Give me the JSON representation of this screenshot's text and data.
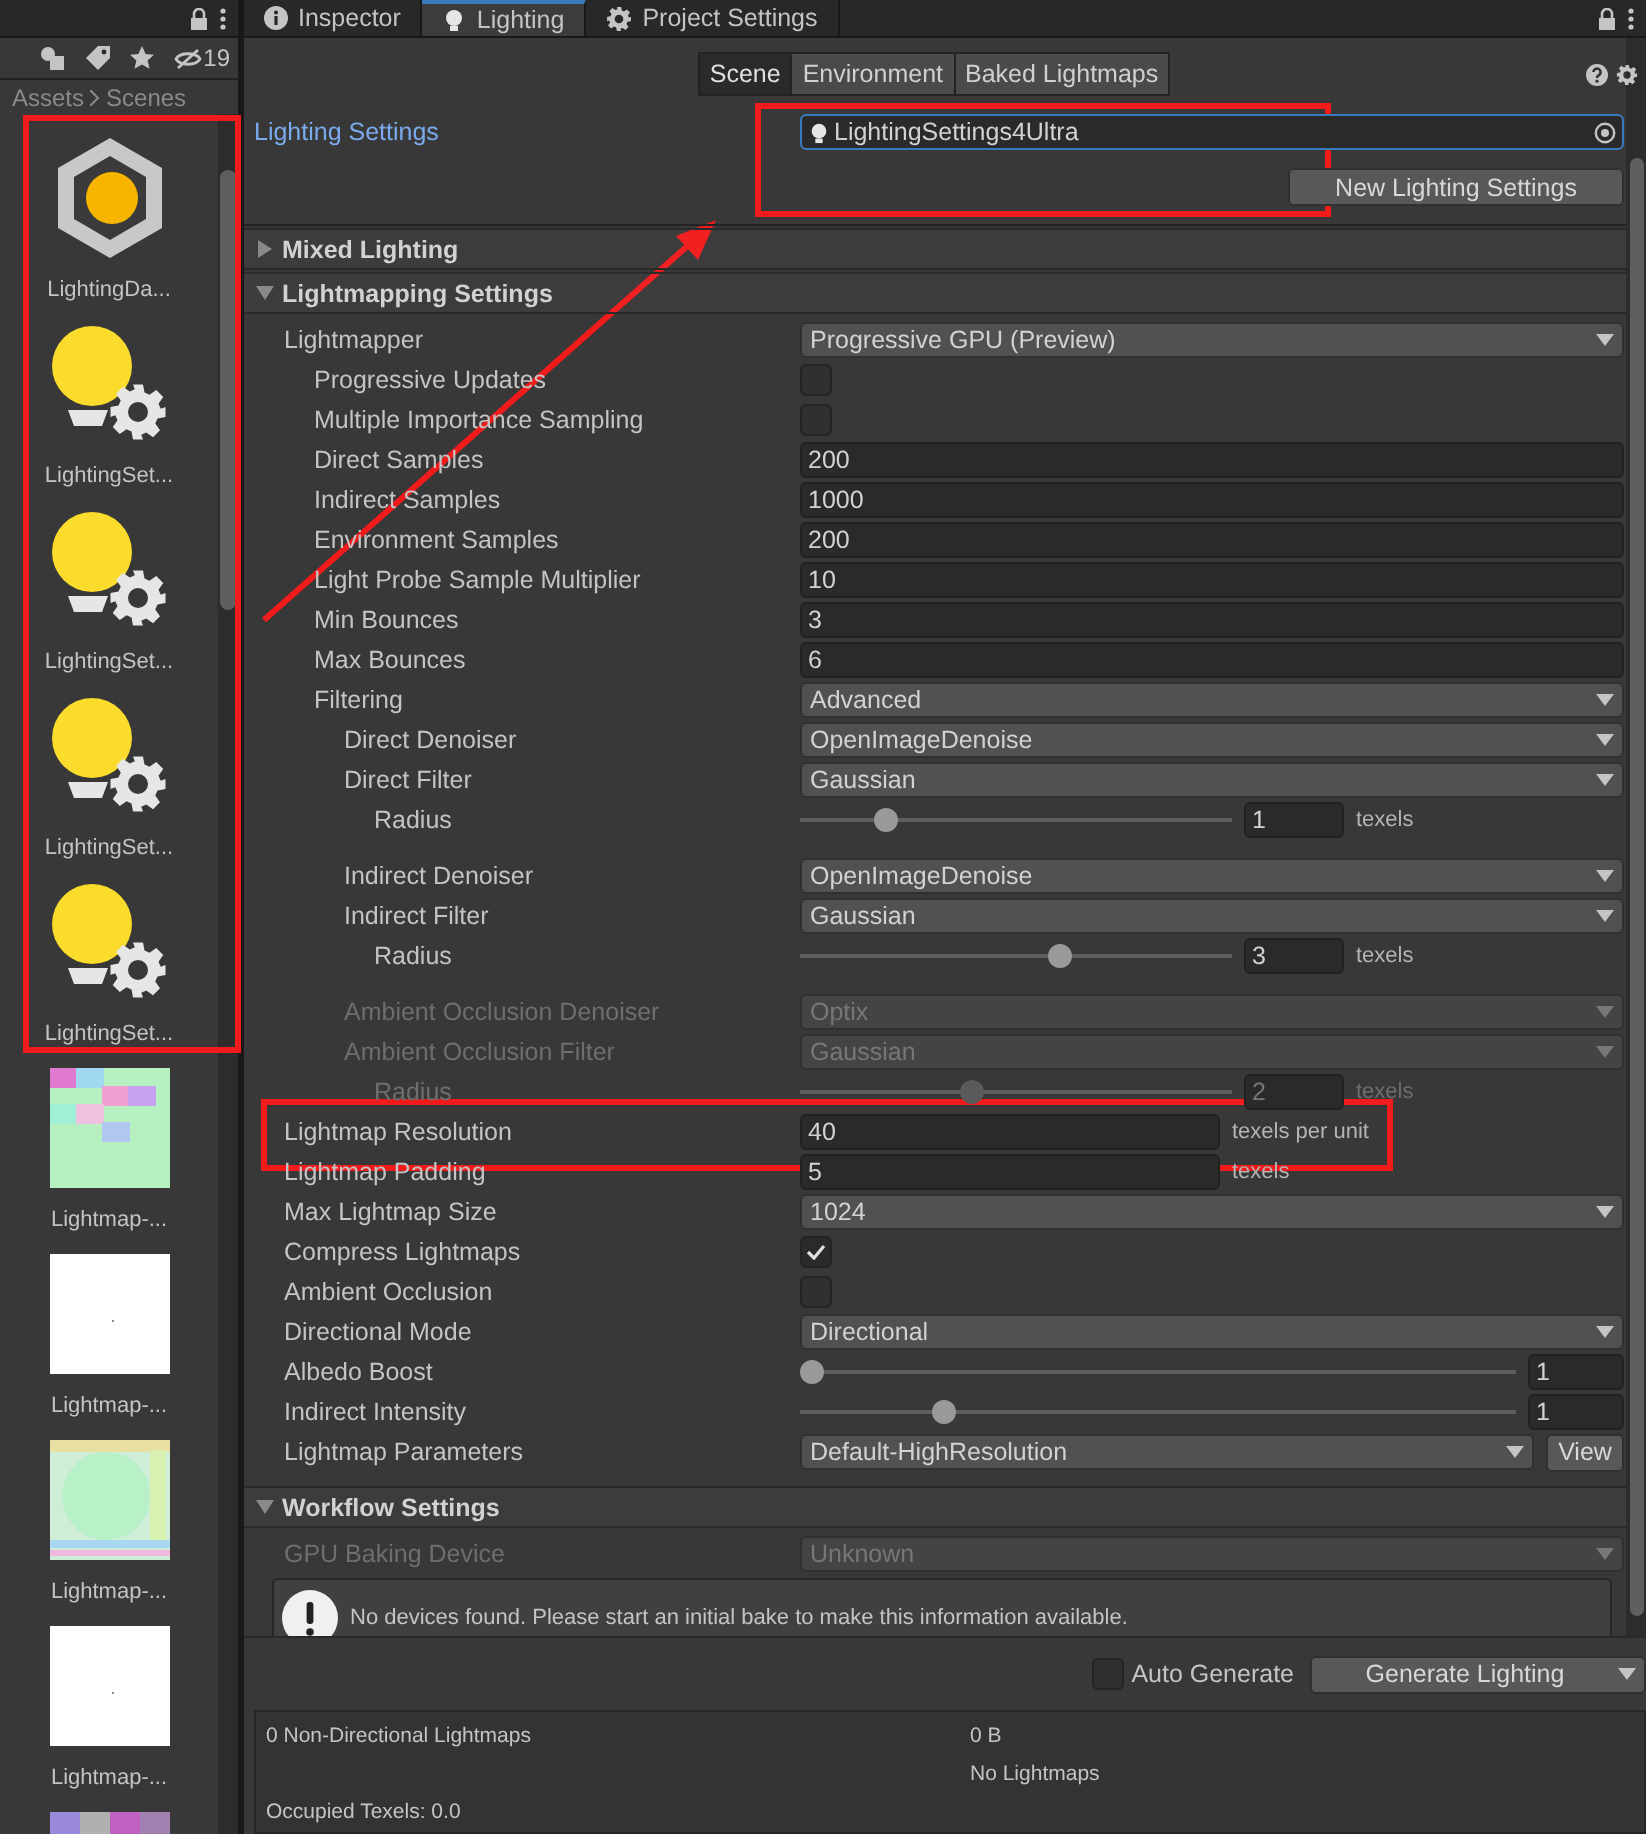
{
  "project_panel": {
    "hidden_count": "19",
    "breadcrumb": [
      "Assets",
      "Scenes"
    ],
    "assets": [
      {
        "kind": "lighting-data",
        "name": "LightingDa..."
      },
      {
        "kind": "lighting-settings",
        "name": "LightingSet..."
      },
      {
        "kind": "lighting-settings",
        "name": "LightingSet..."
      },
      {
        "kind": "lighting-settings",
        "name": "LightingSet..."
      },
      {
        "kind": "lighting-settings",
        "name": "LightingSet..."
      },
      {
        "kind": "picture",
        "name": "Lightmap-..."
      },
      {
        "kind": "picture",
        "name": "Lightmap-..."
      },
      {
        "kind": "picture",
        "name": "Lightmap-..."
      },
      {
        "kind": "picture",
        "name": "Lightmap-..."
      },
      {
        "kind": "picture"
      }
    ]
  },
  "tabs": [
    {
      "label": "Inspector",
      "kind": "info",
      "selected": false
    },
    {
      "label": "Lighting",
      "kind": "bulb",
      "selected": true
    },
    {
      "label": "Project Settings",
      "kind": "gear",
      "selected": false
    }
  ],
  "subtabs": [
    {
      "label": "Scene",
      "selected": true
    },
    {
      "label": "Environment",
      "selected": false
    },
    {
      "label": "Baked Lightmaps",
      "selected": false
    }
  ],
  "lighting_settings": {
    "label": "Lighting Settings",
    "asset": "LightingSettings4Ultra",
    "button": "New Lighting Settings"
  },
  "sections": [
    {
      "title": "Mixed Lighting",
      "expanded": false
    },
    {
      "title": "Lightmapping Settings",
      "expanded": true,
      "rows": [
        {
          "label": "Lightmapper",
          "kind": "dropdown",
          "value": "Progressive GPU (Preview)",
          "children": [
            {
              "label": "Progressive Updates",
              "kind": "checkbox",
              "checked": false
            },
            {
              "label": "Multiple Importance Sampling",
              "kind": "checkbox",
              "checked": false
            },
            {
              "label": "Direct Samples",
              "kind": "number",
              "value": "200"
            },
            {
              "label": "Indirect Samples",
              "kind": "number",
              "value": "1000"
            },
            {
              "label": "Environment Samples",
              "kind": "number",
              "value": "200"
            },
            {
              "label": "Light Probe Sample Multiplier",
              "kind": "number",
              "value": "10"
            },
            {
              "label": "Min Bounces",
              "kind": "number",
              "value": "3"
            },
            {
              "label": "Max Bounces",
              "kind": "number",
              "value": "6"
            },
            {
              "label": "Filtering",
              "kind": "dropdown",
              "value": "Advanced",
              "children": [
                {
                  "label": "Direct Denoiser",
                  "kind": "dropdown",
                  "value": "OpenImageDenoise"
                },
                {
                  "label": "Direct Filter",
                  "kind": "dropdown",
                  "value": "Gaussian",
                  "children": [
                    {
                      "label": "Radius",
                      "kind": "slider",
                      "level": 0.2,
                      "value": "1",
                      "unit": "texels"
                    }
                  ]
                },
                {
                  "label": "Indirect Denoiser",
                  "kind": "dropdown",
                  "value": "OpenImageDenoise"
                },
                {
                  "label": "Indirect Filter",
                  "kind": "dropdown",
                  "value": "Gaussian",
                  "children": [
                    {
                      "label": "Radius",
                      "kind": "slider",
                      "level": 0.6,
                      "value": "3",
                      "unit": "texels"
                    }
                  ]
                },
                {
                  "label": "Ambient Occlusion Denoiser",
                  "kind": "dropdown",
                  "value": "Optix",
                  "disabled": true
                },
                {
                  "label": "Ambient Occlusion Filter",
                  "kind": "dropdown",
                  "value": "Gaussian",
                  "disabled": true,
                  "children": [
                    {
                      "label": "Radius",
                      "kind": "slider",
                      "level": 0.4,
                      "value": "2",
                      "unit": "texels",
                      "disabled": true
                    }
                  ]
                }
              ]
            }
          ]
        },
        {
          "label": "Lightmap Resolution",
          "kind": "field-unit",
          "value": "40",
          "unit": "texels per unit"
        },
        {
          "label": "Lightmap Padding",
          "kind": "field-unit",
          "value": "5",
          "unit": "texels"
        },
        {
          "label": "Max Lightmap Size",
          "kind": "dropdown",
          "value": "1024"
        },
        {
          "label": "Compress Lightmaps",
          "kind": "checkbox",
          "checked": true
        },
        {
          "label": "Ambient Occlusion",
          "kind": "checkbox",
          "checked": false
        },
        {
          "label": "Directional Mode",
          "kind": "dropdown",
          "value": "Directional"
        },
        {
          "label": "Albedo Boost",
          "kind": "slider",
          "level": 0,
          "value": "1"
        },
        {
          "label": "Indirect Intensity",
          "kind": "slider",
          "level": 0.2,
          "value": "1"
        },
        {
          "label": "Lightmap Parameters",
          "kind": "dropdown",
          "value": "Default-HighResolution",
          "button": "View"
        }
      ]
    },
    {
      "title": "Workflow Settings",
      "expanded": true,
      "rows": [
        {
          "label": "GPU Baking Device",
          "kind": "dropdown",
          "value": "Unknown",
          "disabled": true
        }
      ],
      "message": "No devices found. Please start an initial bake to make this information available."
    }
  ],
  "auto_generate": {
    "label": "Auto Generate",
    "checked": false
  },
  "generate_button": "Generate Lighting",
  "stats": [
    {
      "left": "0 Non-Directional Lightmaps",
      "right": "0 B"
    },
    {
      "right": "No Lightmaps"
    },
    {
      "left": "Occupied Texels: 0.0"
    }
  ]
}
